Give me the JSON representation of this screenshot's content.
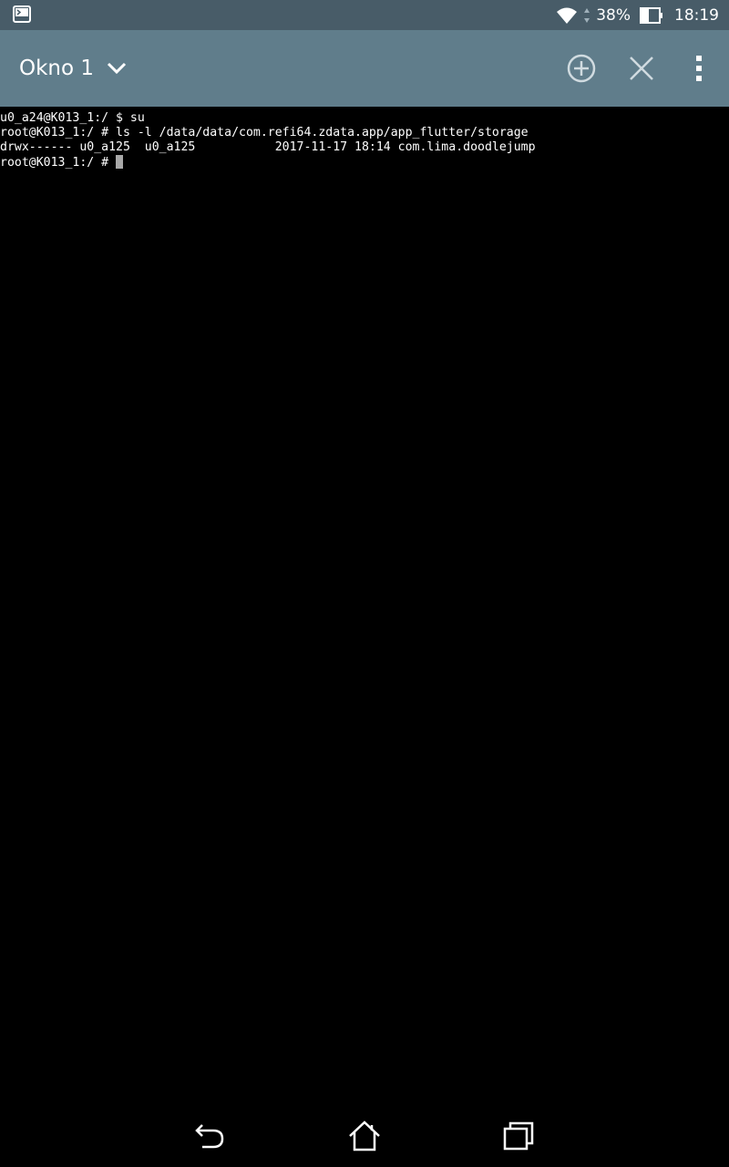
{
  "status_bar": {
    "battery_percent": "38%",
    "time": "18:19"
  },
  "app_bar": {
    "window_title": "Okno 1"
  },
  "terminal": {
    "lines": [
      "u0_a24@K013_1:/ $ su",
      "root@K013_1:/ # ls -l /data/data/com.refi64.zdata.app/app_flutter/storage",
      "drwx------ u0_a125  u0_a125           2017-11-17 18:14 com.lima.doodlejump",
      "root@K013_1:/ # "
    ]
  },
  "icons": {
    "terminal_notification": "terminal-icon",
    "wifi": "wifi-icon",
    "data_activity": "data-activity-icon",
    "battery": "battery-icon",
    "window_dropdown": "chevron-down-icon",
    "add_window": "add-circle-icon",
    "close_window": "close-icon",
    "overflow_menu": "more-vert-icon",
    "back": "back-icon",
    "home": "home-icon",
    "recents": "recents-icon"
  },
  "colors": {
    "status_bar": "#485c68",
    "app_bar": "#607d8b",
    "terminal_bg": "#000000",
    "terminal_text": "#ffffff",
    "cursor": "#a8a8a8"
  }
}
